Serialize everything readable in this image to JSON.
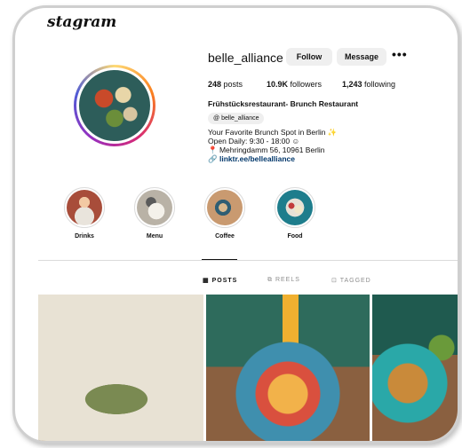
{
  "header": {
    "brand_text": "stagram"
  },
  "profile": {
    "username": "belle_alliance",
    "follow_label": "Follow",
    "message_label": "Message",
    "more_label": "•••",
    "posts_count": "248",
    "posts_label": "posts",
    "followers_count": "10.9K",
    "followers_label": "followers",
    "following_count": "1,243",
    "following_label": "following",
    "display_name": "Frühstücksrestaurant- Brunch Restaurant",
    "threads_handle": "belle_alliance",
    "bio_line_1": "Your Favorite Brunch Spot in Berlin ✨",
    "bio_line_2": "Open Daily: 9:30 - 18:00 ☺",
    "bio_line_3": "📍 Mehringdamm 56, 10961 Berlin",
    "link": "linktr.ee/bellealliance"
  },
  "highlights": [
    {
      "label": "Drinks"
    },
    {
      "label": "Menu"
    },
    {
      "label": "Coffee"
    },
    {
      "label": "Food"
    }
  ],
  "tabs": [
    {
      "label": "POSTS",
      "icon": "grid-icon",
      "active": true
    },
    {
      "label": "REELS",
      "icon": "reels-icon",
      "active": false
    },
    {
      "label": "TAGGED",
      "icon": "tagged-icon",
      "active": false
    }
  ],
  "posts": [
    {
      "icon": "post-image-pasta-wine"
    },
    {
      "icon": "post-image-fruit-bowl"
    },
    {
      "icon": "post-image-toast"
    }
  ],
  "colors": {
    "follow_bg": "#efefef",
    "link": "#00376b",
    "teal": "#2d5d5a"
  }
}
